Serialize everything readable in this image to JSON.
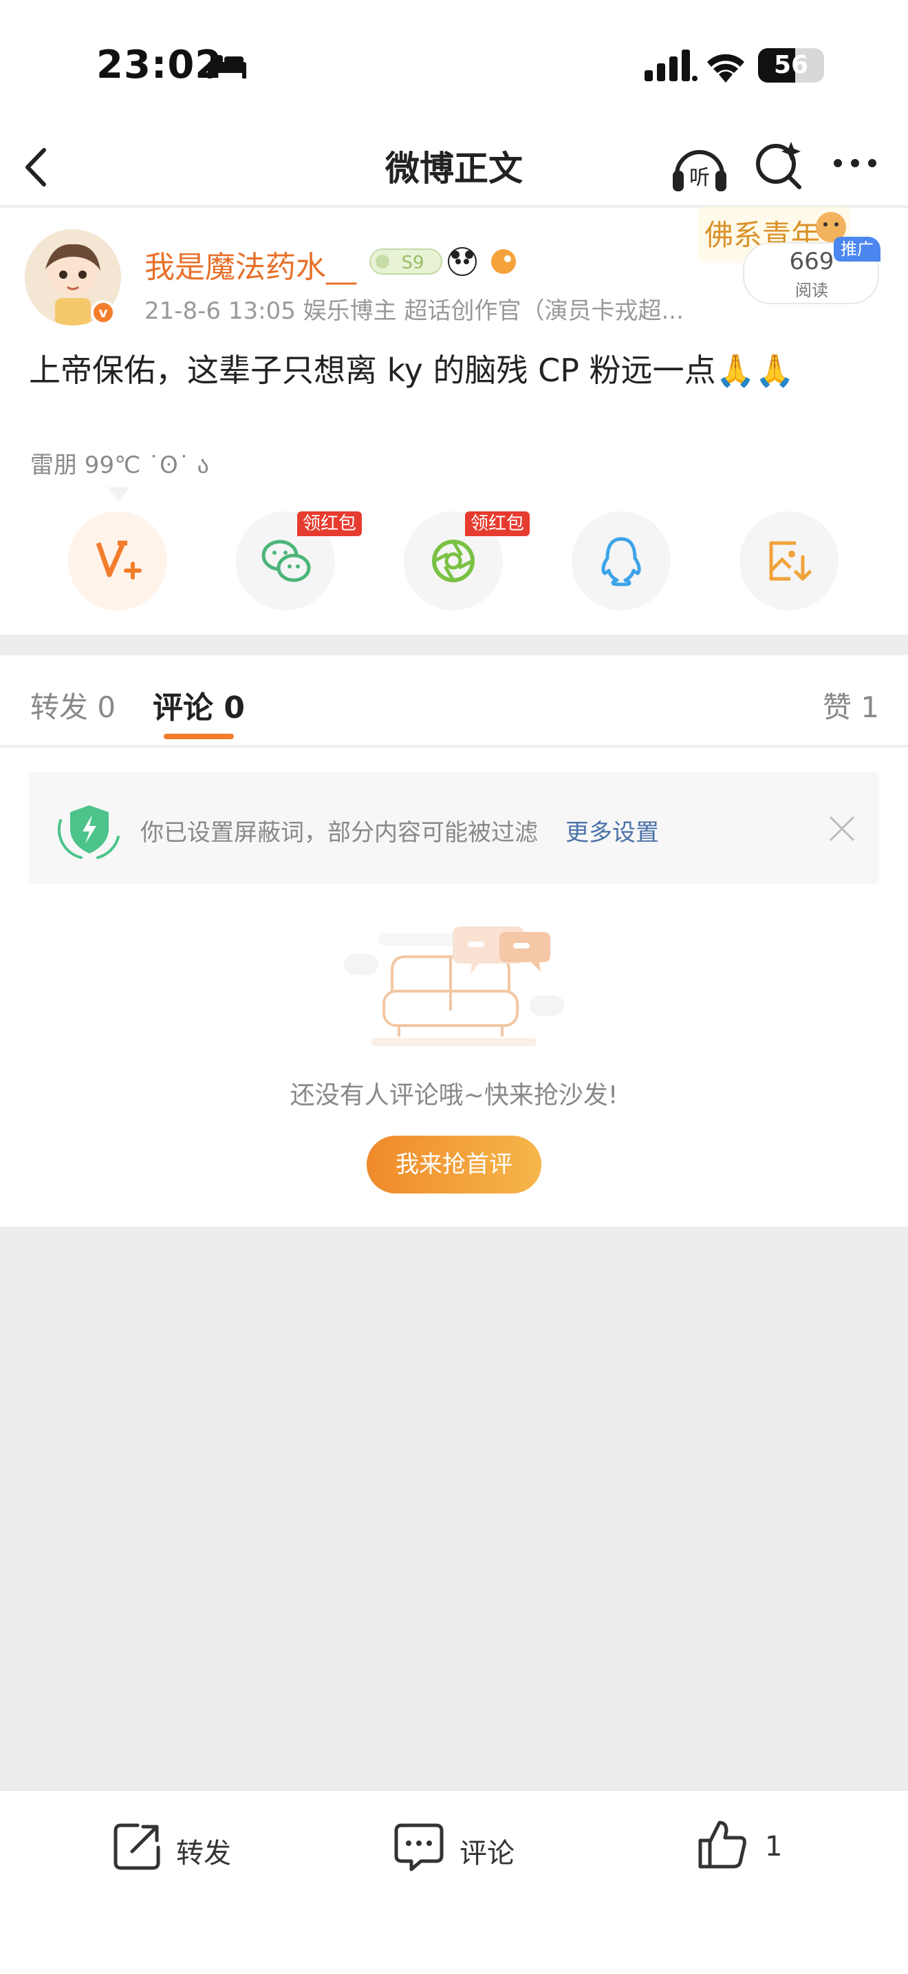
{
  "status_bar": {
    "time": "23:02",
    "battery": "56",
    "battery_level": 0.56
  },
  "nav": {
    "title": "微博正文"
  },
  "post": {
    "username": "我是魔法药水__",
    "meta": "21-8-6 13:05  娱乐博主 超话创作官（演员卡戎超...",
    "read_count": "669",
    "read_label": "阅读",
    "promo_tag": "推广",
    "text": "上帝保佑，这辈子只想离 ky 的脑残 CP 粉远一点🙏🙏",
    "share_hint": "雷朋 99℃ ˙ʘ˙ ა"
  },
  "share_targets": [
    {
      "name": "weibo-vplus",
      "icon": "vplus-icon"
    },
    {
      "name": "wechat",
      "icon": "wechat-icon",
      "tag": "领红包"
    },
    {
      "name": "moments",
      "icon": "moments-icon",
      "tag": "领红包"
    },
    {
      "name": "qq",
      "icon": "qq-icon"
    },
    {
      "name": "save-image",
      "icon": "save-image-icon"
    }
  ],
  "tabs": {
    "repost": "转发 0",
    "comment": "评论 0",
    "like": "赞 1"
  },
  "notice": {
    "text": "你已设置屏蔽词，部分内容可能被过滤",
    "link": "更多设置"
  },
  "empty_state": {
    "text": "还没有人评论哦~快来抢沙发!",
    "button": "我来抢首评"
  },
  "bottom_bar": {
    "repost": "转发",
    "comment": "评论",
    "like": "1"
  },
  "colors": {
    "accent": "#f27d2b",
    "link": "#4a72a8",
    "promo": "#4c86ef",
    "red_tag": "#e63c2f"
  }
}
